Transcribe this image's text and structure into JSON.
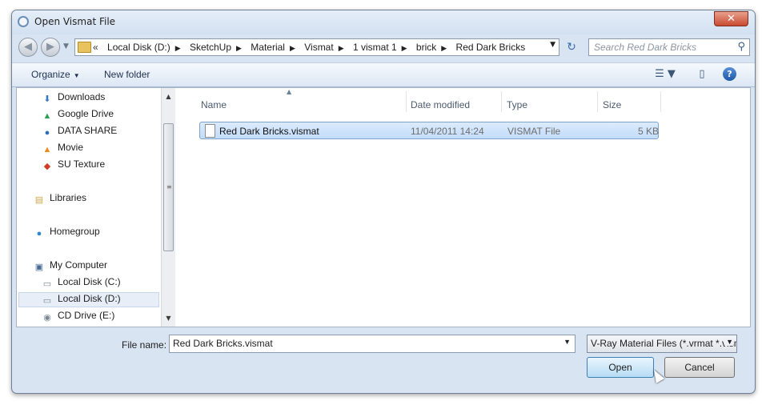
{
  "window": {
    "title": "Open Vismat File",
    "close_label": "✕"
  },
  "nav": {
    "back_label": "◀",
    "forward_label": "▶",
    "recent_label": "▼",
    "breadcrumb_prefix": "«",
    "breadcrumbs": [
      "Local Disk (D:)",
      "SketchUp",
      "Material",
      "Vismat",
      "1 vismat 1",
      "brick",
      "Red Dark Bricks"
    ],
    "breadcrumb_separator": "▶",
    "address_dropdown": "▼",
    "refresh_icon": "↻",
    "search_placeholder": "Search Red Dark Bricks",
    "search_icon": "⚲"
  },
  "toolbar": {
    "organize_label": "Organize",
    "organize_arrow": "▼",
    "new_folder_label": "New folder",
    "views_icon": "☰ ▼",
    "preview_icon": "▯",
    "help_icon": "?"
  },
  "sidebar": {
    "items": [
      {
        "label": "Downloads",
        "icon": "⬇",
        "icon_name": "downloads-icon",
        "color": "#3a77c4"
      },
      {
        "label": "Google Drive",
        "icon": "▲",
        "icon_name": "google-drive-icon",
        "color": "#2da14f"
      },
      {
        "label": "DATA SHARE",
        "icon": "●",
        "icon_name": "data-share-icon",
        "color": "#2a6fb7"
      },
      {
        "label": "Movie",
        "icon": "▲",
        "icon_name": "vlc-icon",
        "color": "#f08a1c"
      },
      {
        "label": "SU Texture",
        "icon": "◆",
        "icon_name": "sketchup-icon",
        "color": "#d23a2a"
      },
      {
        "label": "Libraries",
        "icon": "▤",
        "icon_name": "libraries-icon",
        "color": "#c9a74a"
      },
      {
        "label": "Homegroup",
        "icon": "●",
        "icon_name": "homegroup-icon",
        "color": "#2f86c9"
      },
      {
        "label": "My Computer",
        "icon": "▣",
        "icon_name": "computer-icon",
        "color": "#4a6a92"
      },
      {
        "label": "Local Disk (C:)",
        "icon": "▭",
        "icon_name": "drive-c-icon",
        "color": "#7b8793"
      },
      {
        "label": "Local Disk (D:)",
        "icon": "▭",
        "icon_name": "drive-d-icon",
        "color": "#7b8793"
      },
      {
        "label": "CD Drive (E:)",
        "icon": "◉",
        "icon_name": "cd-drive-icon",
        "color": "#7b8793"
      }
    ],
    "selected": "Local Disk (D:)",
    "scroll_up": "▲",
    "scroll_down": "▼",
    "scroll_grip": "≡"
  },
  "file_list": {
    "columns": [
      "Name",
      "Date modified",
      "Type",
      "Size"
    ],
    "sort_indicator": "▲",
    "rows": [
      {
        "name": "Red Dark Bricks.vismat",
        "date": "11/04/2011 14:24",
        "type": "VISMAT File",
        "size": "5 KB"
      }
    ]
  },
  "footer": {
    "file_name_label": "File name:",
    "file_name_value": "Red Dark Bricks.vismat",
    "file_name_dropdown": "▼",
    "filter_label": "V-Ray Material Files (*.vrmat *.vismat)",
    "filter_dropdown": "▼",
    "open_label": "Open",
    "cancel_label": "Cancel"
  },
  "colors": {
    "accent": "#3c7fb1",
    "selection": "#c1dcfa",
    "close": "#c94a30"
  }
}
